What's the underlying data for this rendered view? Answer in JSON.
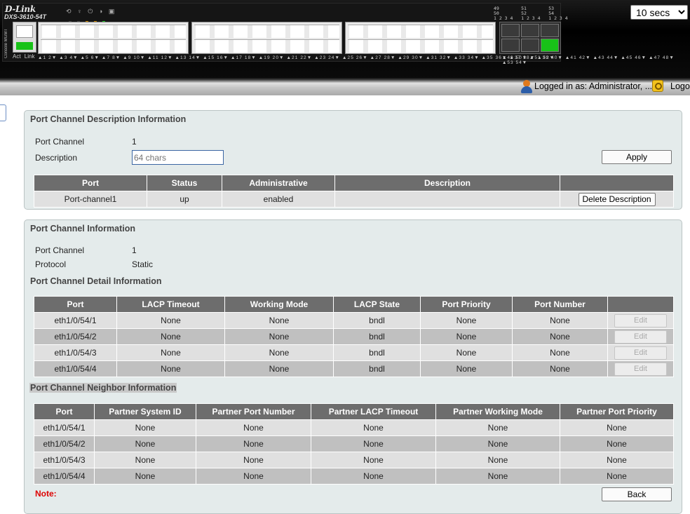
{
  "header": {
    "brand": "D-Link",
    "model": "DXS-3610-54T",
    "mgmt_label": "Console MGMT",
    "act_link_label": "Act Link",
    "port_labels": "▲1 2▼ ▲3 4▼ ▲5 6▼ ▲7 8▼ ▲9 10▼ ▲11 12▼ ▲13 14▼ ▲15 16▼ ▲17 18▼ ▲19 20▼ ▲21 22▼ ▲23 24▼ ▲25 26▼ ▲27 28▼ ▲29 30▼ ▲31 32▼ ▲33 34▼ ▲35 36▼ ▲37 38▼ ▲39 40▼ ▲41 42▼ ▲43 44▼ ▲45 46▼ ▲47 48▼",
    "sfp_top": "49        51        53\n50        52        54\n1 2 3 4   1 2 3 4   1 2 3 4",
    "sfp_labels": "▲49 50▼ ▲51 52▼ ▲53 54▼",
    "refresh": {
      "selected": "10 secs",
      "options": [
        "10 secs"
      ]
    }
  },
  "login_bar": {
    "logged_in": "Logged in as: Administrator, ...",
    "logout": "Logo"
  },
  "panel_description": {
    "title": "Port Channel Description Information",
    "port_channel_label": "Port Channel",
    "port_channel_value": "1",
    "description_label": "Description",
    "description_placeholder": "64 chars",
    "apply_label": "Apply",
    "columns": [
      "Port",
      "Status",
      "Administrative",
      "Description",
      ""
    ],
    "rows": [
      {
        "port": "Port-channel1",
        "status": "up",
        "administrative": "enabled",
        "description": "",
        "action": "Delete Description"
      }
    ]
  },
  "panel_info": {
    "title": "Port Channel Information",
    "port_channel_label": "Port Channel",
    "port_channel_value": "1",
    "protocol_label": "Protocol",
    "protocol_value": "Static",
    "detail_title": "Port Channel Detail Information",
    "detail_columns": [
      "Port",
      "LACP Timeout",
      "Working Mode",
      "LACP State",
      "Port Priority",
      "Port Number",
      ""
    ],
    "detail_rows": [
      {
        "port": "eth1/0/54/1",
        "lacp_timeout": "None",
        "working_mode": "None",
        "lacp_state": "bndl",
        "port_priority": "None",
        "port_number": "None",
        "action": "Edit"
      },
      {
        "port": "eth1/0/54/2",
        "lacp_timeout": "None",
        "working_mode": "None",
        "lacp_state": "bndl",
        "port_priority": "None",
        "port_number": "None",
        "action": "Edit"
      },
      {
        "port": "eth1/0/54/3",
        "lacp_timeout": "None",
        "working_mode": "None",
        "lacp_state": "bndl",
        "port_priority": "None",
        "port_number": "None",
        "action": "Edit"
      },
      {
        "port": "eth1/0/54/4",
        "lacp_timeout": "None",
        "working_mode": "None",
        "lacp_state": "bndl",
        "port_priority": "None",
        "port_number": "None",
        "action": "Edit"
      }
    ],
    "neighbor_title": "Port Channel Neighbor Information",
    "neighbor_columns": [
      "Port",
      "Partner System ID",
      "Partner Port Number",
      "Partner LACP Timeout",
      "Partner Working Mode",
      "Partner Port Priority"
    ],
    "neighbor_rows": [
      {
        "port": "eth1/0/54/1",
        "system_id": "None",
        "port_number": "None",
        "lacp_timeout": "None",
        "working_mode": "None",
        "port_priority": "None"
      },
      {
        "port": "eth1/0/54/2",
        "system_id": "None",
        "port_number": "None",
        "lacp_timeout": "None",
        "working_mode": "None",
        "port_priority": "None"
      },
      {
        "port": "eth1/0/54/3",
        "system_id": "None",
        "port_number": "None",
        "lacp_timeout": "None",
        "working_mode": "None",
        "port_priority": "None"
      },
      {
        "port": "eth1/0/54/4",
        "system_id": "None",
        "port_number": "None",
        "lacp_timeout": "None",
        "working_mode": "None",
        "port_priority": "None"
      }
    ],
    "note_label": "Note:",
    "back_label": "Back"
  },
  "colors": {
    "panel_bg": "#e4ebeb",
    "table_header": "#6d6d6d",
    "row_light": "#e0e0e0",
    "row_dark": "#c0c0c0",
    "note": "#dd0000",
    "link_green": "#18c218"
  },
  "icons": {
    "user": "user-icon",
    "logout": "key-icon",
    "mgmt_port": "ethernet-port-icon"
  }
}
